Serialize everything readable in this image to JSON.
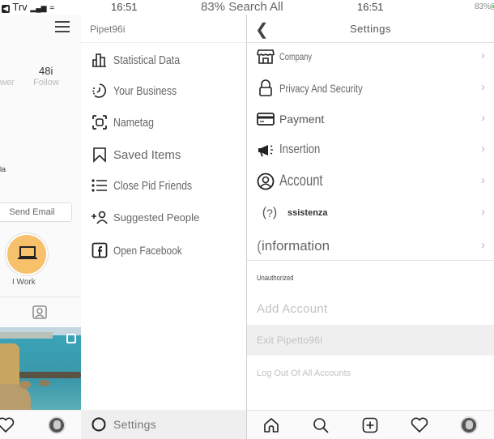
{
  "status_bar": {
    "carrier": "Trv",
    "time_left": "16:51",
    "search_text": "83% Search All",
    "time_right": "16:51",
    "battery_percent": "83%",
    "battery_level": 0.83
  },
  "profile": {
    "stats": [
      {
        "value": "",
        "label": "wer"
      },
      {
        "value": "48i",
        "label": "Follow"
      }
    ],
    "bio_fragment": "la",
    "send_email_label": "Send Email",
    "highlight_label": "I Work",
    "icons": [
      "menu-icon",
      "laptop-icon",
      "tagged-icon",
      "heart-icon",
      "avatar"
    ]
  },
  "menu": {
    "username": "Pipet96i",
    "items": [
      {
        "label": "Statistical Data",
        "icon": "bar-chart-icon"
      },
      {
        "label": "Your Business",
        "icon": "activity-clock-icon"
      },
      {
        "label": "Nametag",
        "icon": "nametag-scan-icon"
      },
      {
        "label": "Saved Items",
        "icon": "bookmark-icon"
      },
      {
        "label": "Close Pid Friends",
        "icon": "list-icon"
      },
      {
        "label": "Suggested People",
        "icon": "add-person-icon"
      },
      {
        "label": "Open Facebook",
        "icon": "facebook-icon"
      }
    ],
    "settings_label": "Settings"
  },
  "settings": {
    "title": "Settings",
    "back_icon": "chevron-left-icon",
    "items": [
      {
        "label": "Company",
        "icon": "store-icon"
      },
      {
        "label": "Privacy And Security",
        "icon": "lock-icon"
      },
      {
        "label": "Payment",
        "icon": "credit-card-icon"
      },
      {
        "label": "Insertion",
        "icon": "megaphone-icon"
      },
      {
        "label": "Account",
        "icon": "account-circle-icon"
      },
      {
        "label": "ssistenza",
        "icon": "help-icon"
      },
      {
        "label": "information",
        "icon": "info-icon"
      }
    ],
    "section_header": "Unauthorized",
    "account_actions": [
      {
        "label": "Add Account"
      },
      {
        "label": "Exit Pipetto96i"
      },
      {
        "label": "Log Out Of All Accounts"
      }
    ]
  },
  "tabbar": {
    "tabs": [
      "home-icon",
      "search-icon",
      "new-post-icon",
      "heart-icon",
      "profile-avatar"
    ]
  }
}
